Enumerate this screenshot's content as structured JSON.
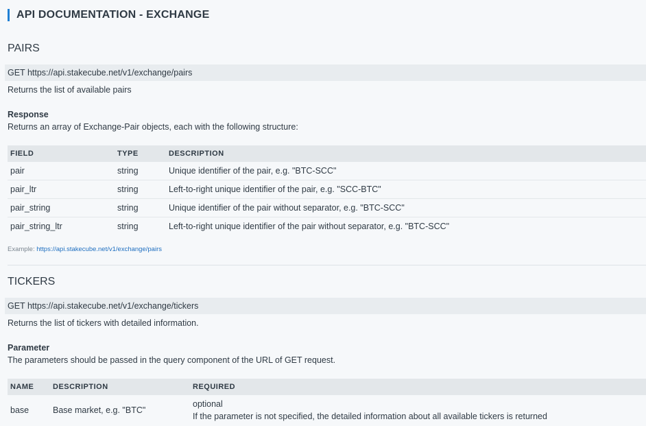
{
  "doc": {
    "title": "API DOCUMENTATION - EXCHANGE"
  },
  "pairs": {
    "title": "PAIRS",
    "endpoint": "GET https://api.stakecube.net/v1/exchange/pairs",
    "summary": "Returns the list of available pairs",
    "response_heading": "Response",
    "response_text": "Returns an array of Exchange-Pair objects, each with the following structure:",
    "table": {
      "headers": [
        "FIELD",
        "TYPE",
        "DESCRIPTION"
      ],
      "rows": [
        {
          "field": "pair",
          "type": "string",
          "description": "Unique identifier of the pair, e.g. \"BTC-SCC\""
        },
        {
          "field": "pair_ltr",
          "type": "string",
          "description": "Left-to-right unique identifier of the pair, e.g. \"SCC-BTC\""
        },
        {
          "field": "pair_string",
          "type": "string",
          "description": "Unique identifier of the pair without separator, e.g. \"BTC-SCC\""
        },
        {
          "field": "pair_string_ltr",
          "type": "string",
          "description": "Left-to-right unique identifier of the pair without separator, e.g. \"BTC-SCC\""
        }
      ]
    },
    "example_label": "Example:",
    "example_link": "https://api.stakecube.net/v1/exchange/pairs"
  },
  "tickers": {
    "title": "TICKERS",
    "endpoint": "GET https://api.stakecube.net/v1/exchange/tickers",
    "summary": "Returns the list of tickers with detailed information.",
    "parameter_heading": "Parameter",
    "parameter_text": "The parameters should be passed in the query component of the URL of GET request.",
    "table": {
      "headers": [
        "NAME",
        "DESCRIPTION",
        "REQUIRED"
      ],
      "rows": [
        {
          "name": "base",
          "description": "Base market, e.g. \"BTC\"",
          "required": "optional",
          "required_note": "If the parameter is not specified, the detailed information about all available tickers is returned"
        }
      ]
    }
  },
  "colors": {
    "accent": "#1f7fd4",
    "link": "#1f6fc0",
    "header_bg": "#e3e7ea",
    "page_bg": "#f6f8fa"
  }
}
